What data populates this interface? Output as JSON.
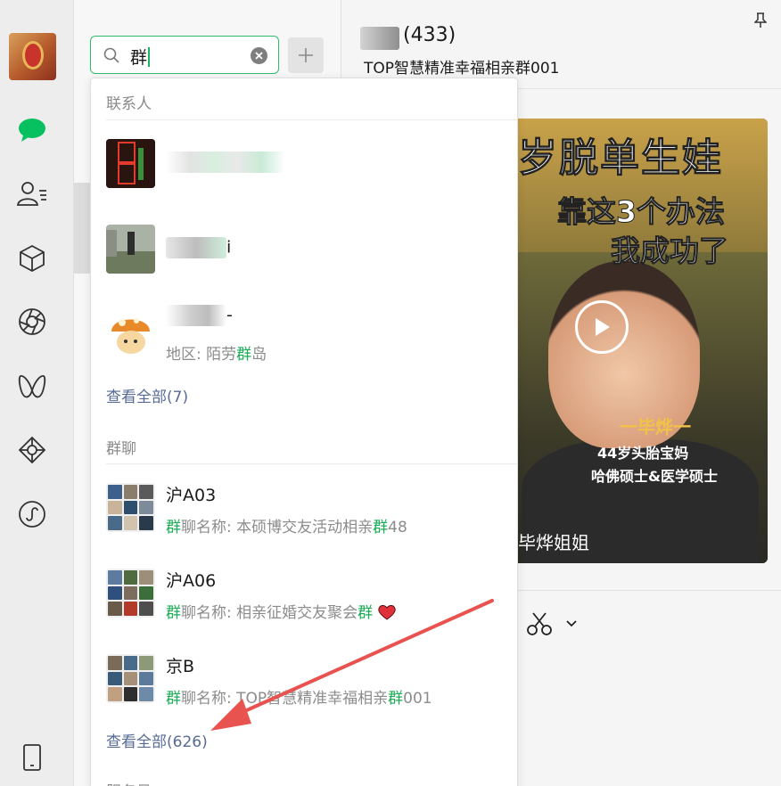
{
  "search": {
    "query": "群"
  },
  "header": {
    "member_count": "(433)",
    "group_title": "TOP智慧精准幸福相亲群001"
  },
  "video": {
    "headline_1": "岁脱单生娃",
    "headline_2": "靠这3个办法",
    "headline_3": "我成功了",
    "overlay_name": "一毕烨一",
    "overlay_line_1": "44岁头胎宝妈",
    "overlay_line_2": "哈佛硕士&医学硕士",
    "caption": "毕烨姐姐"
  },
  "dropdown": {
    "contacts_title": "联系人",
    "contacts": [
      {
        "name_suffix": "",
        "sub": ""
      },
      {
        "name_suffix": "i",
        "sub": ""
      },
      {
        "name_suffix": "-",
        "sub_prefix": "地区: 陌劳",
        "sub_hl": "群",
        "sub_suffix": "岛"
      }
    ],
    "contacts_see_all": "查看全部(7)",
    "groups_title": "群聊",
    "groups": [
      {
        "name": "沪A03",
        "sub_hl": "群",
        "sub_mid": "聊名称: 本硕博交友活动相亲",
        "sub_hl2": "群",
        "sub_end": "48"
      },
      {
        "name": "沪A06",
        "sub_hl": "群",
        "sub_mid": "聊名称: 相亲征婚交友聚会",
        "sub_hl2": "群",
        "sub_end": ""
      },
      {
        "name": "京B",
        "sub_hl": "群",
        "sub_mid": "聊名称: TOP智慧精准幸福相亲",
        "sub_hl2": "群",
        "sub_end": "001"
      }
    ],
    "groups_see_all": "查看全部(626)",
    "next_section": "服务号"
  },
  "colors": {
    "accent_green": "#1aad55",
    "link_blue": "#576b95",
    "arrow_red": "#e8524f"
  }
}
